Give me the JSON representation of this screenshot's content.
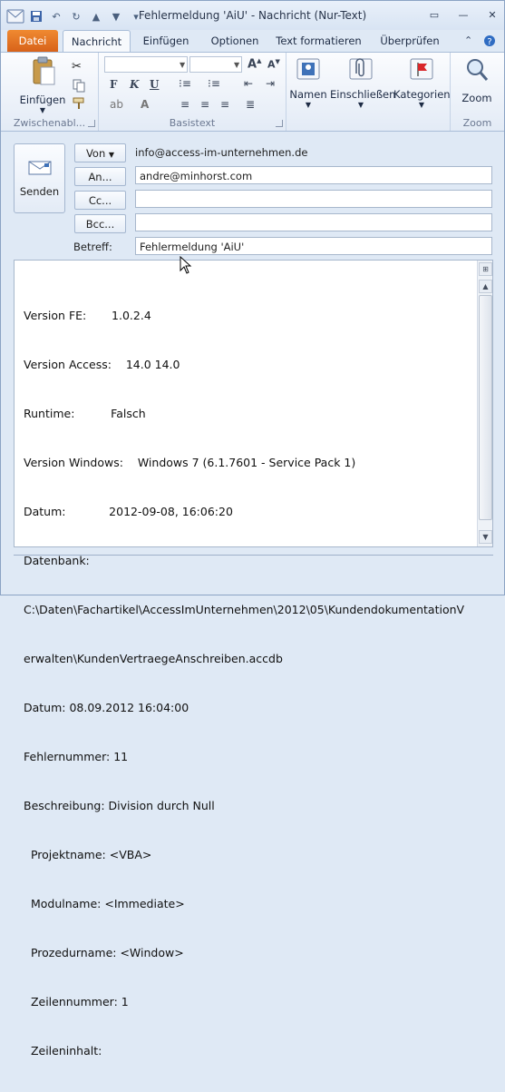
{
  "window": {
    "title": "Fehlermeldung 'AiU'  -  Nachricht (Nur-Text)"
  },
  "tabs": [
    {
      "label": "Datei"
    },
    {
      "label": "Nachricht"
    },
    {
      "label": "Einfügen"
    },
    {
      "label": "Optionen"
    },
    {
      "label": "Text formatieren"
    },
    {
      "label": "Überprüfen"
    }
  ],
  "ribbon": {
    "clipboard": {
      "paste_label": "Einfügen",
      "group_label": "Zwischenabl..."
    },
    "basic_text": {
      "group_label": "Basistext"
    },
    "names": {
      "label": "Namen"
    },
    "include": {
      "label": "Einschließen"
    },
    "categories": {
      "label": "Kategorien"
    },
    "zoom": {
      "label": "Zoom",
      "group_label": "Zoom"
    }
  },
  "header": {
    "send_label": "Senden",
    "from_label": "Von",
    "from_value": "info@access-im-unternehmen.de",
    "to_label": "An...",
    "to_value": "andre@minhorst.com",
    "cc_label": "Cc...",
    "cc_value": "",
    "bcc_label": "Bcc...",
    "bcc_value": "",
    "subject_label": "Betreff:",
    "subject_value": "Fehlermeldung 'AiU'"
  },
  "body": {
    "lines": [
      "Version FE:       1.0.2.4",
      "Version Access:    14.0 14.0",
      "Runtime:          Falsch",
      "Version Windows:    Windows 7 (6.1.7601 - Service Pack 1)",
      "Datum:            2012-09-08, 16:06:20",
      "Datenbank:",
      "C:\\Daten\\Fachartikel\\AccessImUnternehmen\\2012\\05\\KundendokumentationV",
      "erwalten\\KundenVertraegeAnschreiben.accdb",
      "Datum: 08.09.2012 16:04:00",
      "Fehlernummer: 11",
      "Beschreibung: Division durch Null",
      "  Projektname: <VBA>",
      "  Modulname: <Immediate>",
      "  Prozedurname: <Window>",
      "  Zeilennummer: 1",
      "  Zeileninhalt:"
    ]
  },
  "colors": {
    "file_tab": "#e8782a",
    "ribbon_bg": "#e3ebf6",
    "window_bg": "#dfe9f5"
  }
}
